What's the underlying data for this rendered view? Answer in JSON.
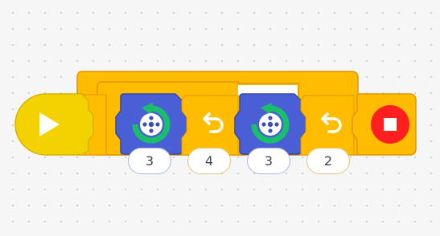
{
  "colors": {
    "canvas": "#f6f6f7",
    "start_block": "#f4d100",
    "loop_block": "#ffbc00",
    "spin_block": "#4a5fd6",
    "stop_block": "#ff1f1f"
  },
  "program": {
    "start_icon": "play-icon",
    "loop_icon": "repeat-loop-bracket",
    "blocks": [
      {
        "type": "spin",
        "icon": "spin-motor-icon",
        "param": "3"
      },
      {
        "type": "repeat",
        "icon": "rotate-counterclockwise-icon",
        "param": "4"
      },
      {
        "type": "spin",
        "icon": "spin-motor-icon",
        "param": "3"
      },
      {
        "type": "repeat",
        "icon": "rotate-counterclockwise-icon",
        "param": "2"
      }
    ],
    "end_icon": "stop-icon"
  }
}
